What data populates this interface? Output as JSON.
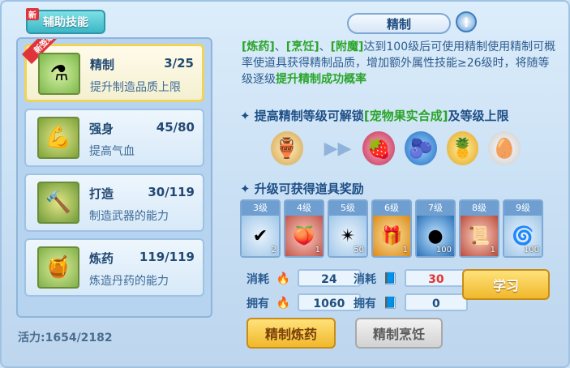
{
  "top_tab": {
    "badge": "新",
    "label": "辅助技能"
  },
  "skills": [
    {
      "name": "精制",
      "level": "3/25",
      "desc": "提升制造品质上限",
      "ribbon": "新签级",
      "icon": "refine-icon"
    },
    {
      "name": "强身",
      "level": "45/80",
      "desc": "提高气血",
      "icon": "muscle-icon"
    },
    {
      "name": "打造",
      "level": "30/119",
      "desc": "制造武器的能力",
      "icon": "hammer-icon"
    },
    {
      "name": "炼药",
      "level": "119/119",
      "desc": "炼造丹药的能力",
      "icon": "cauldron-icon"
    }
  ],
  "vitality": "活力:1654/2182",
  "detail": {
    "title": "精制",
    "info_icon": "!",
    "desc_parts": [
      {
        "text": "[炼药]",
        "green": true
      },
      {
        "text": "、",
        "green": false
      },
      {
        "text": "[烹饪]",
        "green": true
      },
      {
        "text": "、",
        "green": false
      },
      {
        "text": "[附魔]",
        "green": true
      },
      {
        "text": "达到100级后可使用精制使用精制可概率使道具获得精制品质，增加额外属性技能≥26级时，将随等级逐级",
        "green": false
      },
      {
        "text": "提升精制成功概率",
        "green": true
      }
    ],
    "unlock_title_parts": [
      {
        "text": "提高精制等级可解锁",
        "green": false
      },
      {
        "text": "[宠物果实合成]",
        "green": true
      },
      {
        "text": "及等级上限",
        "green": false
      }
    ],
    "reward_title": "升级可获得道具奖励",
    "rewards": [
      {
        "level": "3级",
        "count": "2",
        "icon": "checkmark-icon"
      },
      {
        "level": "4级",
        "count": "1",
        "icon": "fruit-icon"
      },
      {
        "level": "5级",
        "count": "50",
        "icon": "crystal-icon"
      },
      {
        "level": "6级",
        "count": "1",
        "icon": "giftbox-icon"
      },
      {
        "level": "7级",
        "count": "100",
        "icon": "orb-icon"
      },
      {
        "level": "8级",
        "count": "1",
        "icon": "scroll-icon"
      },
      {
        "level": "9级",
        "count": "100",
        "icon": "swirl-icon"
      }
    ],
    "cost_label": "消耗",
    "own_label": "拥有",
    "cost_vitality": "24",
    "own_vitality": "1060",
    "cost_item": "30",
    "own_item": "0",
    "learn_label": "学习",
    "btn_refine_alchemy": "精制炼药",
    "btn_refine_cook": "精制烹饪"
  },
  "colors": {
    "accent_green": "#2aa52a",
    "cost_red": "#e33434",
    "primary_gold": "#f0b82c"
  }
}
